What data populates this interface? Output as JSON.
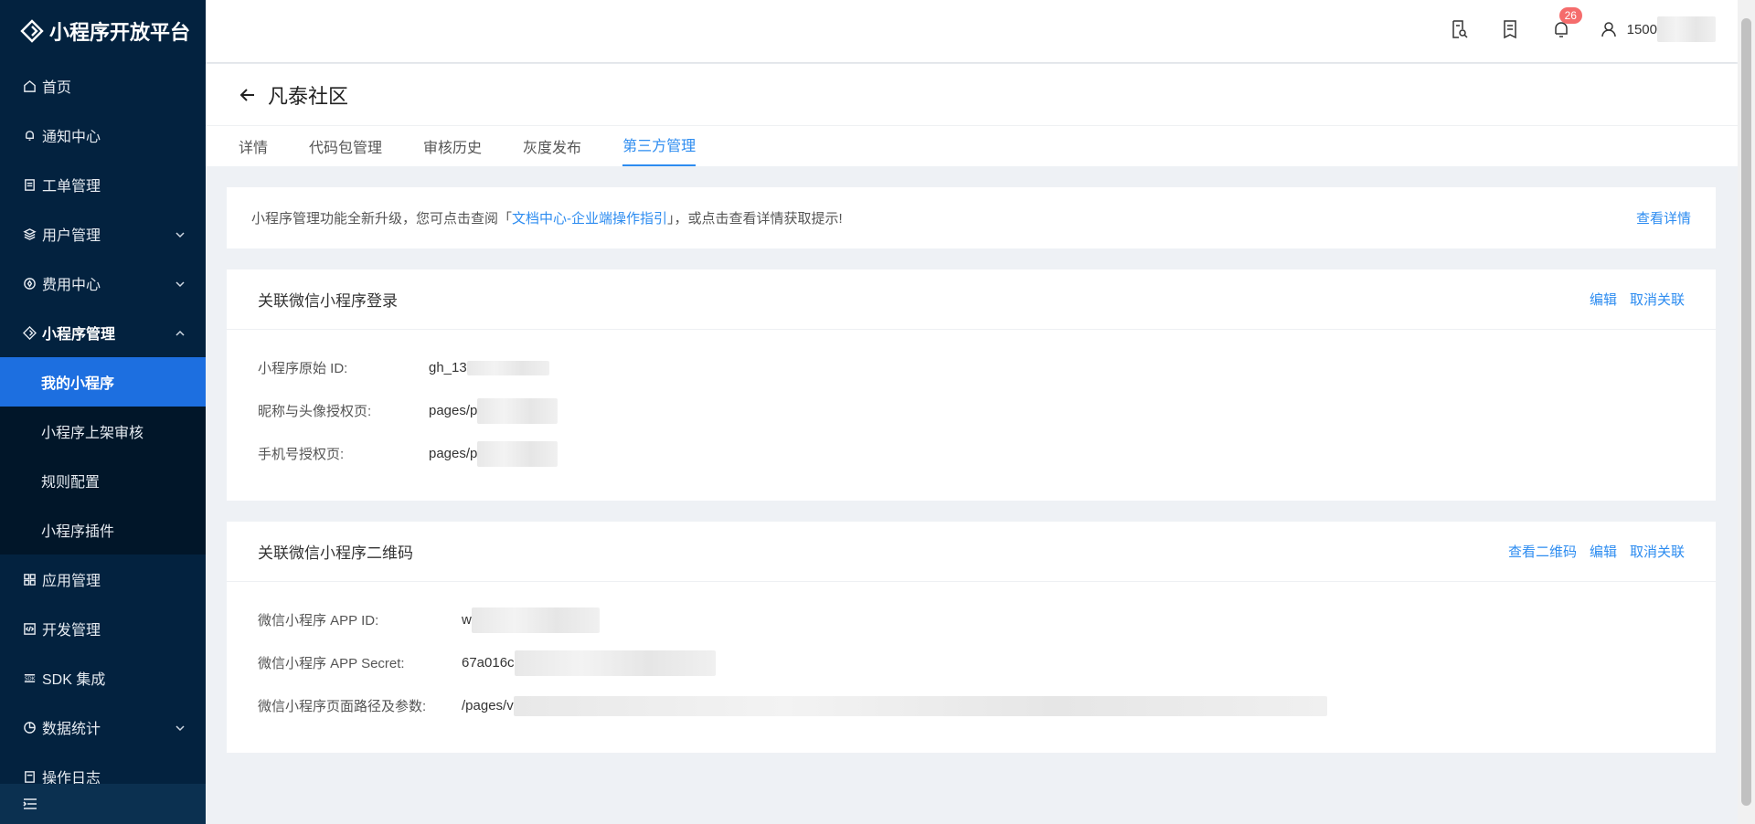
{
  "brand": {
    "name": "小程序开放平台"
  },
  "sidebar": {
    "items": [
      {
        "label": "首页"
      },
      {
        "label": "通知中心"
      },
      {
        "label": "工单管理"
      },
      {
        "label": "用户管理"
      },
      {
        "label": "费用中心"
      },
      {
        "label": "小程序管理"
      },
      {
        "label": "应用管理"
      },
      {
        "label": "开发管理"
      },
      {
        "label": "SDK 集成"
      },
      {
        "label": "数据统计"
      },
      {
        "label": "操作日志"
      }
    ],
    "submenu": [
      {
        "label": "我的小程序"
      },
      {
        "label": "小程序上架审核"
      },
      {
        "label": "规则配置"
      },
      {
        "label": "小程序插件"
      }
    ]
  },
  "header": {
    "notification_count": "26",
    "username_prefix": "1500"
  },
  "page": {
    "title": "凡泰社区",
    "tabs": [
      {
        "label": "详情"
      },
      {
        "label": "代码包管理"
      },
      {
        "label": "审核历史"
      },
      {
        "label": "灰度发布"
      },
      {
        "label": "第三方管理"
      }
    ]
  },
  "notice": {
    "text_before": "小程序管理功能全新升级，您可点击查阅「",
    "link": "文档中心-企业端操作指引",
    "text_after": "」，或点击查看详情获取提示!",
    "more": "查看详情"
  },
  "login_card": {
    "title": "关联微信小程序登录",
    "edit": "编辑",
    "unlink": "取消关联",
    "rows": [
      {
        "label": "小程序原始 ID:",
        "value": "gh_13"
      },
      {
        "label": "昵称与头像授权页:",
        "value": "pages/p"
      },
      {
        "label": "手机号授权页:",
        "value": "pages/p"
      }
    ]
  },
  "qrcode_card": {
    "title": "关联微信小程序二维码",
    "view_qr": "查看二维码",
    "edit": "编辑",
    "unlink": "取消关联",
    "rows": [
      {
        "label": "微信小程序 APP ID:",
        "value": "w"
      },
      {
        "label": "微信小程序 APP Secret:",
        "value": "67a016c"
      },
      {
        "label": "微信小程序页面路径及参数:",
        "value": "/pages/v"
      }
    ]
  }
}
